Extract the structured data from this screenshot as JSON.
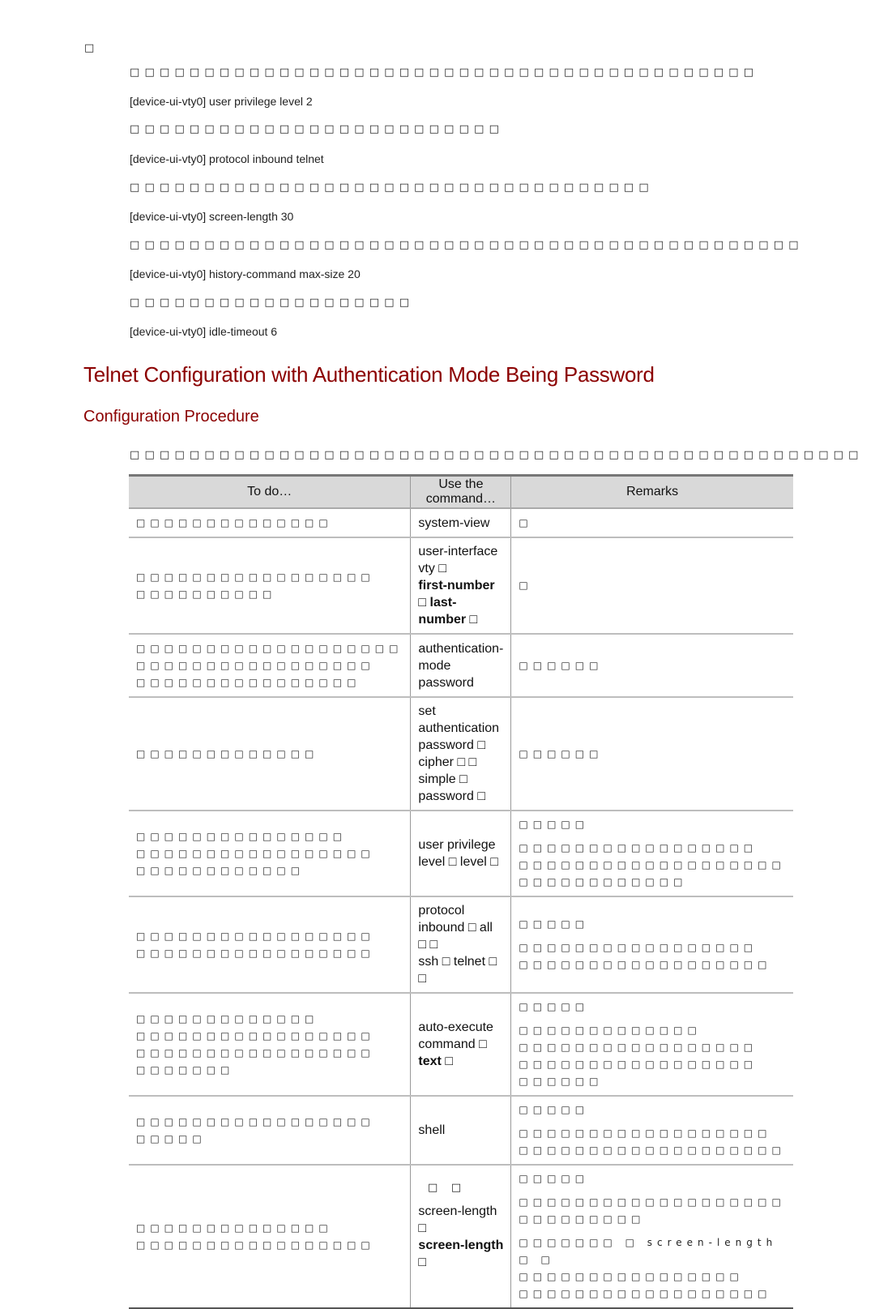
{
  "page": {
    "top_marker": "□",
    "steps": [
      {
        "desc": "□□□□□□□□□□□□□□□□□□□□□□□□□□□□□□□□□□□□□□□□□□",
        "command": "[device-ui-vty0] user privilege level 2"
      },
      {
        "desc": "□□□□□□□□□□□□□□□□□□□□□□□□□",
        "command": "[device-ui-vty0] protocol inbound telnet"
      },
      {
        "desc": "□□□□□□□□□□□□□□□□□□□□□□□□□□□□□□□□□□□",
        "command": "[device-ui-vty0] screen-length 30"
      },
      {
        "desc": "□□□□□□□□□□□□□□□□□□□□□□□□□□□□□□□□□□□□□□□□□□□□□",
        "command": "[device-ui-vty0] history-command max-size 20"
      },
      {
        "desc": "□□□□□□□□□□□□□□□□□□□",
        "command": "[device-ui-vty0] idle-timeout 6"
      }
    ],
    "heading1": "Telnet Configuration with Authentication Mode Being Password",
    "heading2": "Configuration Procedure",
    "intro": "□□□□□□□□□□□□□□□□□□□□□□□□□□□□□□□□□□□□□□□□□□□□□□□□□",
    "page_number": "□ □"
  },
  "table": {
    "headers": [
      "To do…",
      "Use the command…",
      "Remarks"
    ],
    "rows": [
      {
        "todo": [
          "□□□□□□□□□□□□□□"
        ],
        "cmd": [
          {
            "t": "system-view"
          }
        ],
        "remarks": [
          "□"
        ]
      },
      {
        "todo": [
          "□□□□□□□□□□□□□□□□□",
          "□□□□□□□□□□"
        ],
        "cmd": [
          {
            "t": "user-interface vty □"
          },
          {
            "t": "first-number □ last-number □",
            "b": true
          }
        ],
        "remarks": [
          "□"
        ]
      },
      {
        "todo": [
          "□□□□□□□□□□□□□□□□□□□",
          "□□□□□□□□□□□□□□□□□",
          "□□□□□□□□□□□□□□□□"
        ],
        "cmd": [
          {
            "t": "authentication-mode"
          },
          {
            "t": "password"
          }
        ],
        "remarks": [
          "□□□□□□"
        ]
      },
      {
        "todo": [
          "□□□□□□□□□□□□□"
        ],
        "cmd": [
          {
            "t": "set authentication"
          },
          {
            "t": "password □ cipher □ □"
          },
          {
            "t": "simple □ password □",
            "b": false
          }
        ],
        "remarks": [
          "□□□□□□"
        ]
      },
      {
        "todo": [
          "□□□□□□□□□□□□□□□",
          "□□□□□□□□□□□□□□□□□",
          "□□□□□□□□□□□□"
        ],
        "cmd": [
          {
            "t": "user privilege level □ level □"
          }
        ],
        "remarks": [
          "□□□□□",
          "□□□□□□□□□□□□□□□□□ □□□□□□□□□□□□□□□□□□□ □□□□□□□□□□□□"
        ]
      },
      {
        "todo": [
          "□□□□□□□□□□□□□□□□□",
          "□□□□□□□□□□□□□□□□□"
        ],
        "cmd": [
          {
            "t": "protocol inbound □ all □ □"
          },
          {
            "t": "ssh □ telnet □ □"
          }
        ],
        "remarks": [
          "□□□□□",
          "□□□□□□□□□□□□□□□□□ □□□□□□□□□□□□□□□□□□"
        ]
      },
      {
        "todo": [
          "□□□□□□□□□□□□□",
          "□□□□□□□□□□□□□□□□□",
          "□□□□□□□□□□□□□□□□□",
          "□□□□□□□"
        ],
        "cmd": [
          {
            "t": "auto-execute command □"
          },
          {
            "t": "text □",
            "b": true
          }
        ],
        "remarks": [
          "□□□□□",
          "□□□□□□□□□□□□□ □□□□□□□□□□□□□□□□□ □□□□□□□□□□□□□□□□□ □□□□□□"
        ]
      },
      {
        "todo": [
          "□□□□□□□□□□□□□□□□□",
          "□□□□□"
        ],
        "cmd": [
          {
            "t": "shell"
          }
        ],
        "remarks": [
          "□□□□□",
          "□□□□□□□□□□□□□□□□□□ □□□□□□□□□□□□□□□□□□□"
        ]
      },
      {
        "todo": [
          "□□□□□□□□□□□□□□",
          "□□□□□□□□□□□□□□□□□"
        ],
        "cmd": [
          {
            "t": "screen-length □"
          },
          {
            "t": "screen-length □",
            "b": true
          }
        ],
        "remarks": [
          "□□□□□",
          "□□□□□□□□□□□□□□□□□□□ □□□□□□□□□",
          "□□□□□□□ □ screen-length □ □ □□□□□□□□□□□□□□□□ □□□□□□□□□□□□□□□□□□"
        ]
      }
    ]
  }
}
